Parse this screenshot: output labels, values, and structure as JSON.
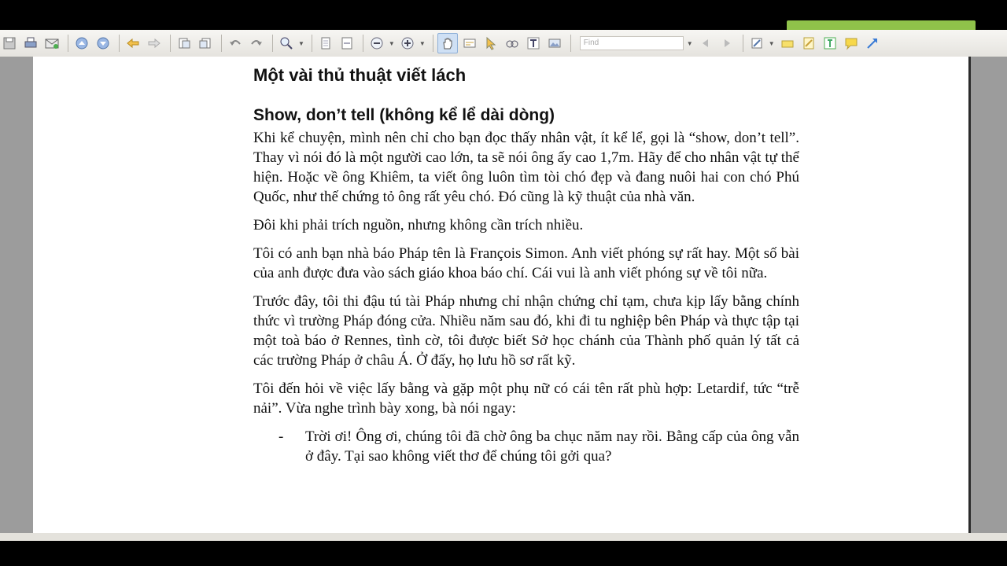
{
  "toolbar": {
    "icons": [
      "save-icon",
      "print-icon",
      "email-icon",
      "page-up-icon",
      "page-down-icon",
      "back-icon",
      "forward-icon",
      "rotate-icon",
      "rotate-alt-icon",
      "undo-icon",
      "redo-icon",
      "zoom-icon",
      "fit-page-icon",
      "fit-width-icon",
      "zoom-out-icon",
      "zoom-in-icon",
      "hand-tool-icon",
      "select-text-icon",
      "pointer-icon",
      "snapshot-icon",
      "text-icon",
      "image-icon",
      "typewriter-icon",
      "highlight-icon",
      "note-icon",
      "textbox-icon",
      "comment-icon",
      "arrow-icon"
    ],
    "find_placeholder": "Find"
  },
  "document": {
    "title": "Một vài thủ thuật viết lách",
    "heading": "Show, don’t tell (không kể lể dài dòng)",
    "paragraphs": [
      "Khi kể chuyện, mình nên chỉ cho bạn đọc thấy nhân vật, ít kể lể, gọi là “show, don’t tell”. Thay vì nói đó là một người cao lớn, ta sẽ nói ông ấy cao 1,7m. Hãy để cho nhân vật tự thể hiện. Hoặc về ông Khiêm, ta viết ông luôn tìm tòi chó đẹp và đang nuôi hai con chó Phú Quốc, như thế chứng tỏ ông rất yêu chó. Đó cũng là kỹ thuật của nhà văn.",
      "Đôi khi phải trích nguồn, nhưng không cần trích nhiều.",
      "Tôi có anh bạn nhà báo Pháp tên là François Simon. Anh viết phóng sự rất hay. Một số bài của anh được đưa vào sách giáo khoa báo chí. Cái vui là anh viết phóng sự về tôi nữa.",
      "Trước đây, tôi thi đậu tú tài Pháp nhưng chỉ nhận chứng chỉ tạm, chưa kịp lấy bằng chính thức vì trường Pháp đóng cửa. Nhiều năm sau đó, khi đi tu nghiệp bên Pháp và thực tập tại một toà báo ở Rennes, tình cờ, tôi được biết Sở học chánh của Thành phố quản lý tất cả các trường Pháp ở châu Á. Ở đấy, họ lưu hồ sơ rất kỹ.",
      "Tôi đến hỏi về việc lấy bằng và gặp một phụ nữ có cái tên rất phù hợp: Letardif, tức “trễ nải”. Vừa nghe trình bày xong, bà nói ngay:"
    ],
    "bullet_dash": "-",
    "bullet_text": "Trời ơi! Ông ơi, chúng tôi đã chờ ông ba chục năm nay rồi. Bằng cấp của ông vẫn ở đây. Tại sao không viết thơ để chúng tôi gởi qua?"
  }
}
